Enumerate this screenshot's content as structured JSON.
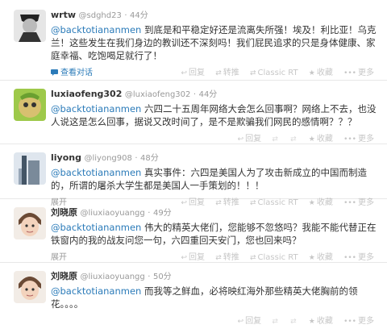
{
  "tweets": [
    {
      "name": "wrtw",
      "handle": "@sdghd23",
      "time": "44分",
      "mention": "@backtotiananmen",
      "text": " 到底是和平稳定好还是流离失所强！埃及！利比亚！乌克兰！这些发生在我们身边的教训还不深刻吗！我们屁民追求的只是身体健康、家庭幸福、吃饱喝足就行了！",
      "action_label": "查看对话"
    },
    {
      "name": "luxiaofeng302",
      "handle": "@luxiaofeng302",
      "time": "44分",
      "mention": "@backtotiananmen",
      "text": " 六四二十五周年网络大会怎么回事啊？网络上不去，也没人说这是怎么回事，据说又改时间了，是不是欺骗我们网民的感情啊？？？",
      "action_label": ""
    },
    {
      "name": "liyong",
      "handle": "@liyong908",
      "time": "48分",
      "mention": "@backtotiananmen",
      "text": " 真实事件：六四是美国人为了攻击新成立的中国而制造的，所谓的屠杀大学生都是美国人一手策划的！！！",
      "action_label": "展开"
    },
    {
      "name": "刘晓原",
      "handle": "@liuxiaoyuangg",
      "time": "49分",
      "mention": "@backtotiananmen",
      "text": " 伟大的精英大佬们，您能够不忽悠吗？我能不能代替正在铁窗内的我的战友问您一句，六四重回天安门，您也回来吗？",
      "action_label": "展开"
    },
    {
      "name": "刘晓原",
      "handle": "@liuxiaoyuangg",
      "time": "50分",
      "mention": "@backtotiananmen",
      "text": " 而我等之鲜血，必将映红海外那些精英大佬胸前的领花。。。。",
      "action_label": ""
    }
  ],
  "ops": {
    "reply": "回复",
    "retweet": "转推",
    "classic_rt": "Classic RT",
    "favorite": "收藏",
    "more": "更多"
  },
  "separator": "·"
}
